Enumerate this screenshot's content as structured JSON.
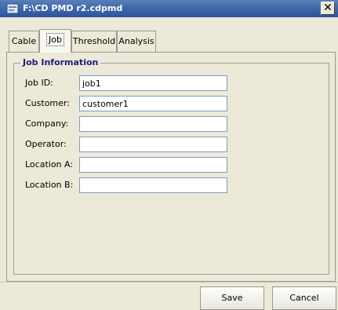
{
  "window": {
    "title": "F:\\CD PMD r2.cdpmd",
    "close_glyph": "✕"
  },
  "tabs": [
    {
      "label": "Cable",
      "active": false
    },
    {
      "label": "Job",
      "active": true
    },
    {
      "label": "Threshold",
      "active": false
    },
    {
      "label": "Analysis",
      "active": false
    }
  ],
  "job_information": {
    "title": "Job Information",
    "fields": [
      {
        "label": "Job ID:",
        "value": ""
      },
      {
        "label": "Customer:",
        "value": ""
      },
      {
        "label": "Company:",
        "value": ""
      },
      {
        "label": "Operator:",
        "value": ""
      },
      {
        "label": "Location A:",
        "value": ""
      },
      {
        "label": "Location B:",
        "value": ""
      }
    ]
  },
  "inputs": {
    "job_id": "job1",
    "customer": "customer1",
    "company": "",
    "operator": "",
    "location_a": "",
    "location_b": ""
  },
  "buttons": {
    "save": "Save",
    "cancel": "Cancel"
  }
}
